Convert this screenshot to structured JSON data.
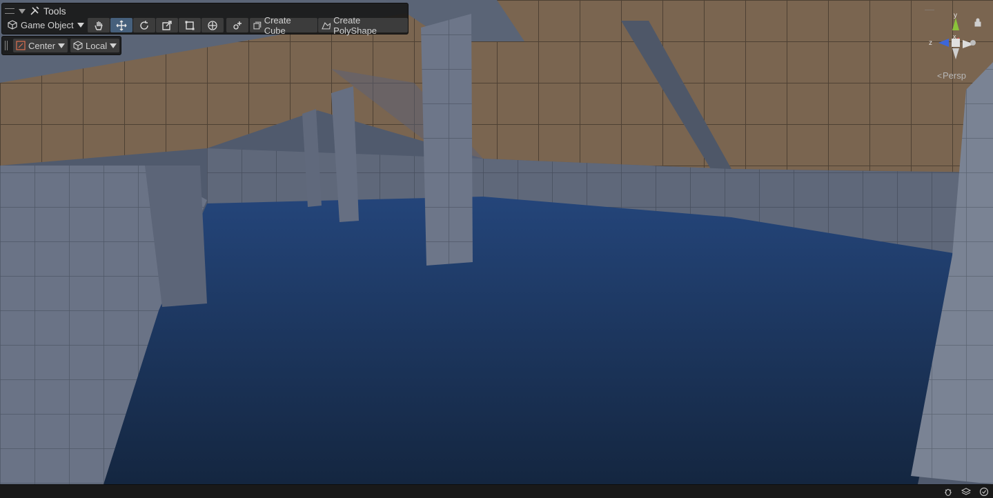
{
  "tools_overlay": {
    "title": "Tools",
    "context_dropdown": "Game Object",
    "transform_tools": [
      {
        "name": "hand-tool",
        "icon": "hand-icon",
        "active": false
      },
      {
        "name": "move-tool",
        "icon": "move-icon",
        "active": true
      },
      {
        "name": "rotate-tool",
        "icon": "rotate-icon",
        "active": false
      },
      {
        "name": "scale-tool",
        "icon": "scale-icon",
        "active": false
      },
      {
        "name": "rect-tool",
        "icon": "rect-icon",
        "active": false
      },
      {
        "name": "transform-tool",
        "icon": "transform-icon",
        "active": false
      }
    ],
    "extra_tool_icon": "custom-tool-icon",
    "create_cube": "Create Cube",
    "create_polyshape": "Create PolyShape"
  },
  "pivot_overlay": {
    "pivot_mode": "Center",
    "pivot_rotation": "Local"
  },
  "scene_gizmo": {
    "axis_y": "y",
    "axis_x": "x",
    "axis_z": "z",
    "projection": "Persp"
  },
  "colors": {
    "accent_active": "#46607c",
    "overlay_bg": "#191919",
    "floor": "#1f3a63",
    "ceiling": "#7a6550",
    "walls": "#505968"
  }
}
